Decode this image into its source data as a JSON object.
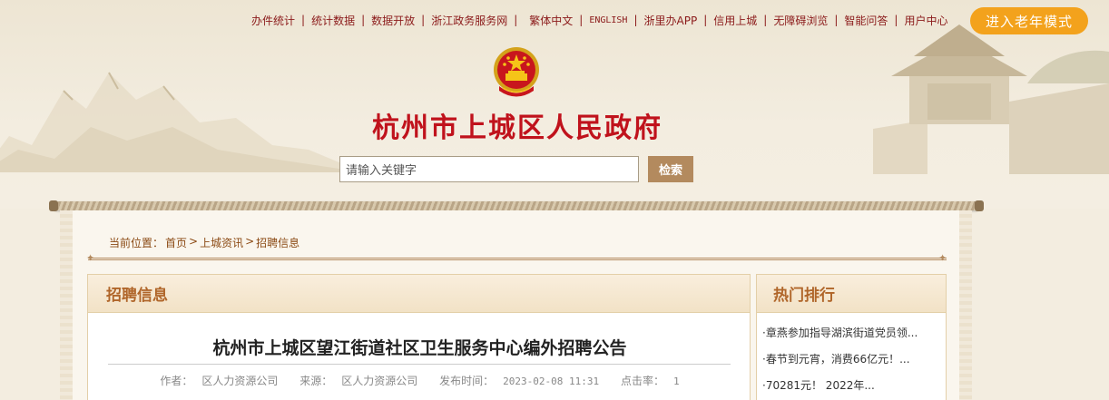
{
  "top_nav": {
    "items": [
      "办件统计",
      "统计数据",
      "数据开放",
      "浙江政务服务网",
      "繁体中文",
      "ENGLISH",
      "浙里办APP",
      "信用上城",
      "无障碍浏览",
      "智能问答",
      "用户中心"
    ],
    "elder_mode": "进入老年模式"
  },
  "site": {
    "title": "杭州市上城区人民政府"
  },
  "search": {
    "placeholder": "请输入关键字",
    "button": "检索"
  },
  "breadcrumb": {
    "prefix": "当前位置：",
    "items": [
      "首页",
      "上城资讯",
      "招聘信息"
    ],
    "separator": ">"
  },
  "main": {
    "section_title": "招聘信息",
    "article": {
      "title": "杭州市上城区望江街道社区卫生服务中心编外招聘公告",
      "author_label": "作者：",
      "author": "区人力资源公司",
      "source_label": "来源：",
      "source": "区人力资源公司",
      "date_label": "发布时间：",
      "date": "2023-02-08 11:31",
      "clicks_label": "点击率：",
      "clicks": "1"
    }
  },
  "sidebar": {
    "title": "热门排行",
    "items": [
      "·章燕参加指导湖滨街道党员领...",
      "·春节到元宵，消费66亿元！...",
      "·70281元！ 2022年..."
    ]
  },
  "colors": {
    "accent_red": "#c0121c",
    "nav_red": "#8b1a1a",
    "elder_orange": "#f3a21c",
    "search_btn": "#b38a5e",
    "panel_title": "#b0662a"
  }
}
